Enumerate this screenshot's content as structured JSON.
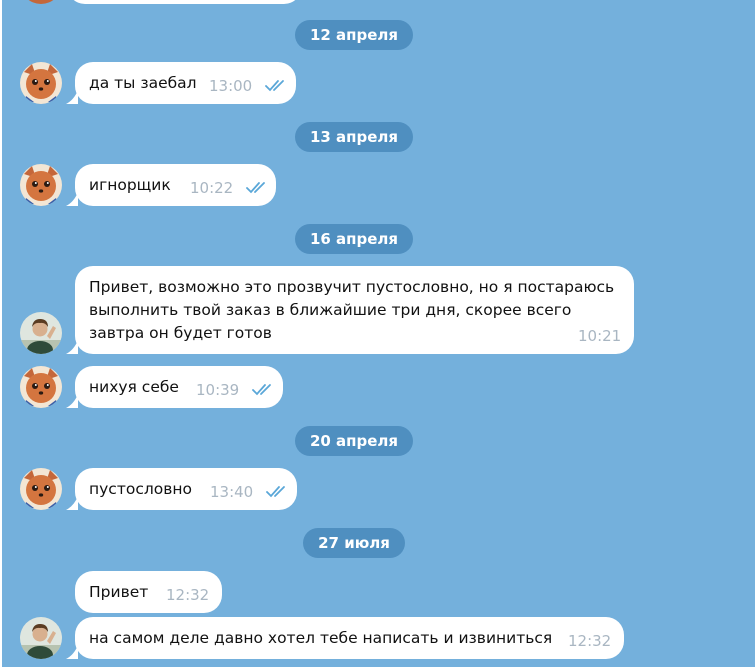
{
  "dates": {
    "d1": "12 апреля",
    "d2": "13 апреля",
    "d3": "16 апреля",
    "d4": "20 апреля",
    "d5": "27 июля"
  },
  "messages": [
    {
      "text": "да ты заебал",
      "time": "13:00",
      "outgoing": true,
      "read": true
    },
    {
      "text": "игнорщик",
      "time": "10:22",
      "outgoing": true,
      "read": true
    },
    {
      "text": "Привет, возможно это прозвучит пустословно, но я постараюсь выполнить твой заказ в ближайшие три дня, скорее всего завтра он будет готов",
      "time": "10:21",
      "outgoing": false
    },
    {
      "text": "нихуя себе",
      "time": "10:39",
      "outgoing": true,
      "read": true
    },
    {
      "text": "пустословно",
      "time": "13:40",
      "outgoing": true,
      "read": true
    },
    {
      "text": "Привет",
      "time": "12:32",
      "outgoing": false
    },
    {
      "text": "на самом деле давно хотел тебе написать и извиниться",
      "time": "12:32",
      "outgoing": false
    }
  ],
  "avatars": {
    "self": "fox-avatar",
    "peer": "person-avatar"
  },
  "colors": {
    "background": "#74b0dc",
    "date_pill": "#4f8fc0",
    "bubble": "#ffffff",
    "check": "#5aa7d8",
    "time": "#a9b6c2"
  }
}
